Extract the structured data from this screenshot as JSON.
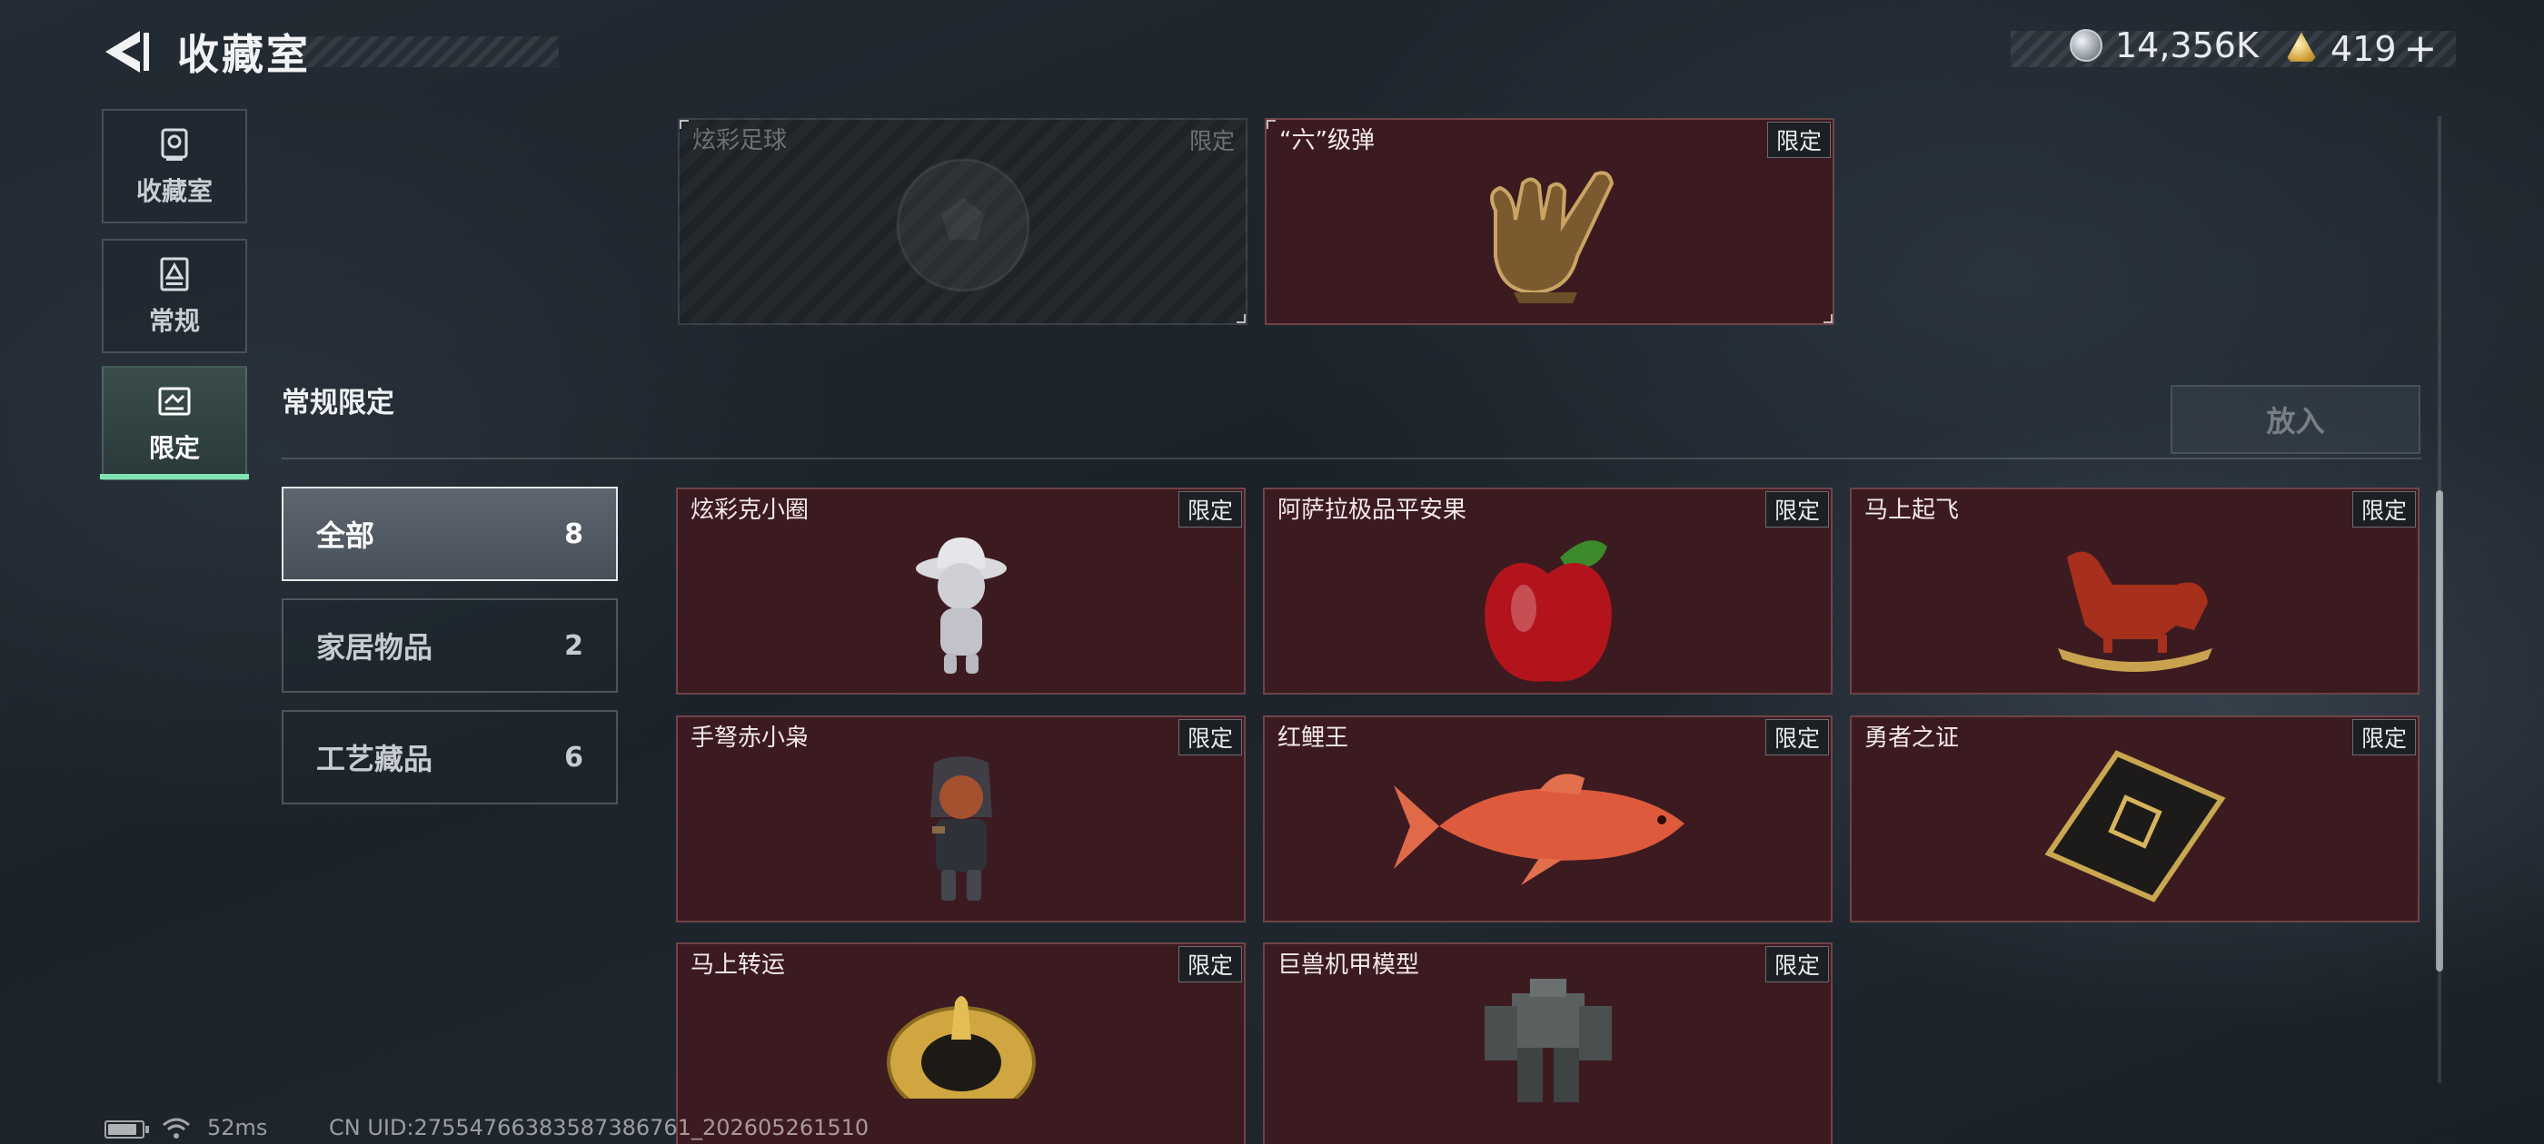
{
  "header": {
    "title": "收藏室",
    "currencies": [
      {
        "icon": "silver-coin-icon",
        "amount": "14,356K"
      },
      {
        "icon": "gold-triangle-coin-icon",
        "amount": "419",
        "add": "+"
      }
    ]
  },
  "nav": {
    "tabs": [
      {
        "label": "收藏室",
        "icon": "trophy-icon",
        "active": false
      },
      {
        "label": "常规",
        "icon": "regular-card-icon",
        "active": false
      },
      {
        "label": "限定",
        "icon": "limited-card-icon",
        "active": true
      }
    ]
  },
  "top_items": [
    {
      "name": "炫彩足球",
      "tag": "限定",
      "locked": true
    },
    {
      "name": "“六”级弹",
      "tag": "限定",
      "locked": false
    }
  ],
  "section": {
    "title": "常规限定",
    "put_in_label": "放入"
  },
  "filters": [
    {
      "label": "全部",
      "count": "8",
      "active": true
    },
    {
      "label": "家居物品",
      "count": "2",
      "active": false
    },
    {
      "label": "工艺藏品",
      "count": "6",
      "active": false
    }
  ],
  "items": [
    {
      "name": "炫彩克小圈",
      "tag": "限定"
    },
    {
      "name": "阿萨拉极品平安果",
      "tag": "限定"
    },
    {
      "name": "马上起飞",
      "tag": "限定"
    },
    {
      "name": "手弩赤小枭",
      "tag": "限定"
    },
    {
      "name": "红鲤王",
      "tag": "限定"
    },
    {
      "name": "勇者之证",
      "tag": "限定"
    },
    {
      "name": "马上转运",
      "tag": "限定"
    },
    {
      "name": "巨兽机甲模型",
      "tag": "限定"
    }
  ],
  "status_bar": {
    "ping": "52ms",
    "uid": "CN UID:27554766383587386761_202605261510"
  }
}
